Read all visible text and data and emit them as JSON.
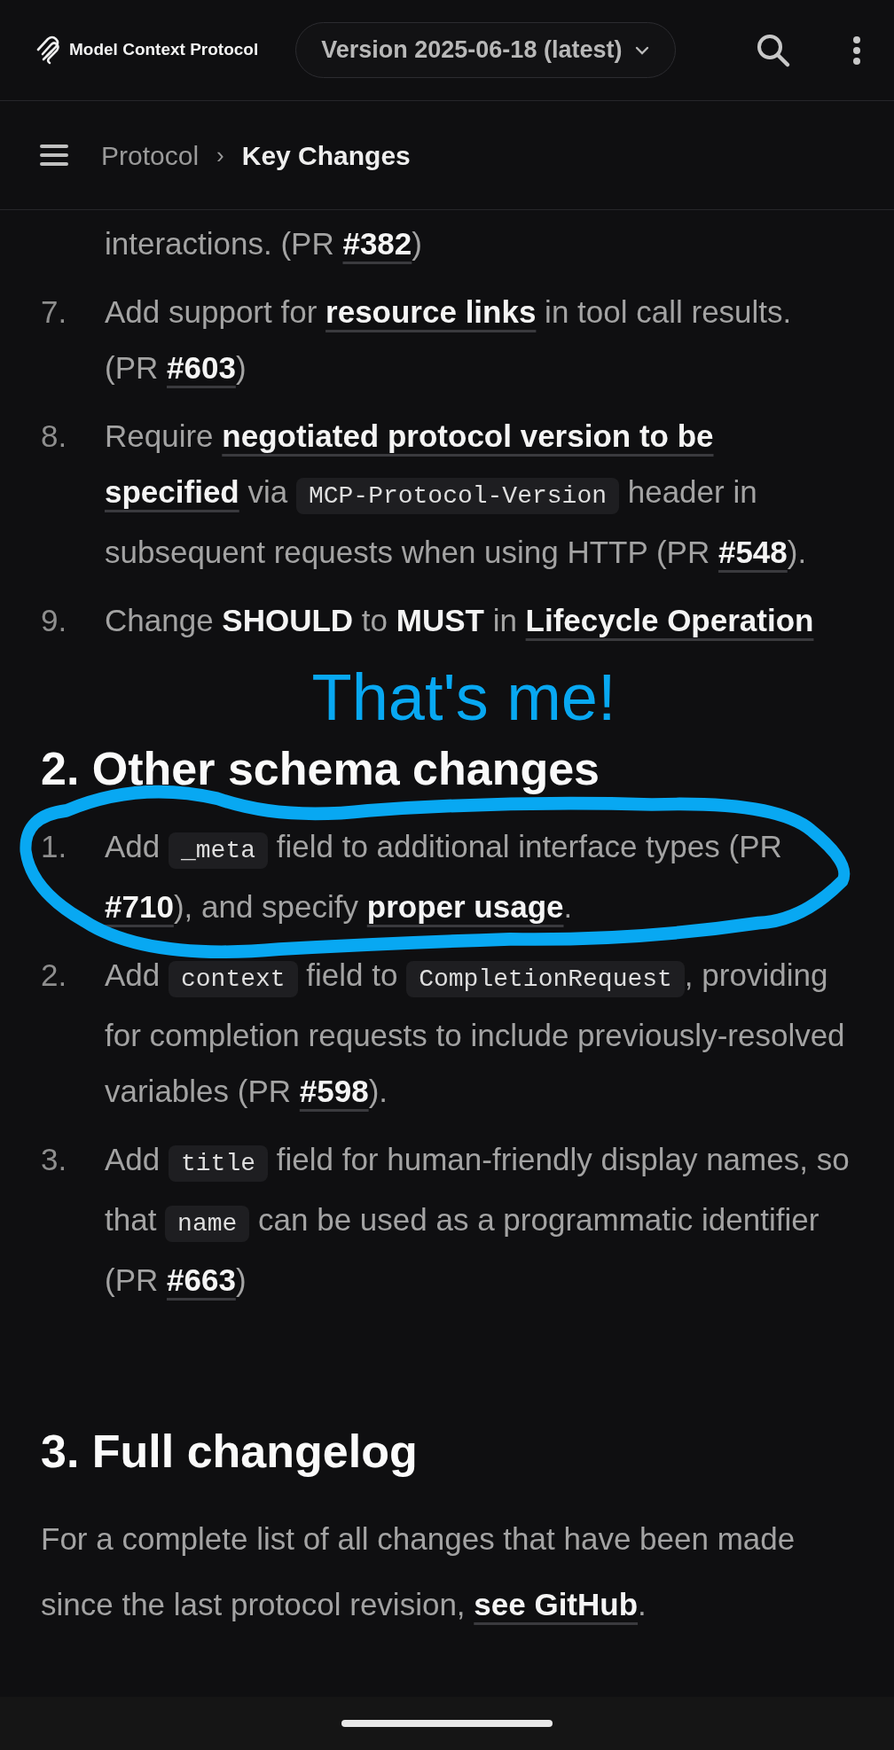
{
  "header": {
    "logo_text": "Model Context Protocol",
    "version": "Version 2025-06-18 (latest)"
  },
  "breadcrumb": {
    "parent": "Protocol",
    "separator": "›",
    "current": "Key Changes"
  },
  "section_1_items": [
    {
      "parts": [
        {
          "kind": "text",
          "text": "interactions. (PR "
        },
        {
          "kind": "link",
          "text": "#382"
        },
        {
          "kind": "text",
          "text": ")"
        }
      ]
    },
    {
      "number": "7.",
      "parts": [
        {
          "kind": "text",
          "text": "Add support for "
        },
        {
          "kind": "link",
          "text": "resource links"
        },
        {
          "kind": "text",
          "text": " in tool call results. (PR "
        },
        {
          "kind": "link",
          "text": "#603"
        },
        {
          "kind": "text",
          "text": ")"
        }
      ]
    },
    {
      "number": "8.",
      "parts": [
        {
          "kind": "text",
          "text": "Require "
        },
        {
          "kind": "link",
          "text": "negotiated protocol version to be"
        },
        {
          "kind": "link",
          "text": "specified"
        },
        {
          "kind": "text",
          "text": " via "
        },
        {
          "kind": "code",
          "text": "MCP-Protocol-Version"
        },
        {
          "kind": "text",
          "text": " header in subsequent requests when using HTTP (PR "
        },
        {
          "kind": "link",
          "text": "#548"
        },
        {
          "kind": "text",
          "text": ")."
        }
      ]
    },
    {
      "number": "9.",
      "parts": [
        {
          "kind": "text",
          "text": "Change "
        },
        {
          "kind": "bold",
          "text": "SHOULD"
        },
        {
          "kind": "text",
          "text": " to "
        },
        {
          "kind": "bold",
          "text": "MUST"
        },
        {
          "kind": "text",
          "text": " in "
        },
        {
          "kind": "link",
          "text": "Lifecycle Operation"
        }
      ]
    }
  ],
  "annotation": {
    "text": "That's me!"
  },
  "section_2": {
    "heading": "2. Other schema changes",
    "items": [
      {
        "number": "1.",
        "circled": true,
        "parts": [
          {
            "kind": "text",
            "text": "Add "
          },
          {
            "kind": "code",
            "text": "_meta"
          },
          {
            "kind": "text",
            "text": " field to additional interface types (PR "
          },
          {
            "kind": "link",
            "text": "#710"
          },
          {
            "kind": "text",
            "text": "), and specify "
          },
          {
            "kind": "link",
            "text": "proper usage"
          },
          {
            "kind": "text",
            "text": "."
          }
        ]
      },
      {
        "number": "2.",
        "circled": false,
        "parts": [
          {
            "kind": "text",
            "text": "Add "
          },
          {
            "kind": "code",
            "text": "context"
          },
          {
            "kind": "text",
            "text": " field to "
          },
          {
            "kind": "code",
            "text": "CompletionRequest"
          },
          {
            "kind": "text",
            "text": ", providing for completion requests to include previously-resolved variables (PR "
          },
          {
            "kind": "link",
            "text": "#598"
          },
          {
            "kind": "text",
            "text": ")."
          }
        ]
      },
      {
        "number": "3.",
        "circled": false,
        "parts": [
          {
            "kind": "text",
            "text": "Add "
          },
          {
            "kind": "code",
            "text": "title"
          },
          {
            "kind": "text",
            "text": " field for human-friendly display names, so that "
          },
          {
            "kind": "code",
            "text": "name"
          },
          {
            "kind": "text",
            "text": " can be used as a programmatic identifier (PR "
          },
          {
            "kind": "link",
            "text": "#663"
          },
          {
            "kind": "text",
            "text": ")"
          }
        ]
      }
    ]
  },
  "section_3": {
    "heading": "3. Full changelog",
    "parts": [
      {
        "kind": "text",
        "text": "For a complete list of all changes that have been made since the last protocol revision, "
      },
      {
        "kind": "link",
        "text": "see GitHub"
      },
      {
        "kind": "text",
        "text": "."
      }
    ]
  }
}
